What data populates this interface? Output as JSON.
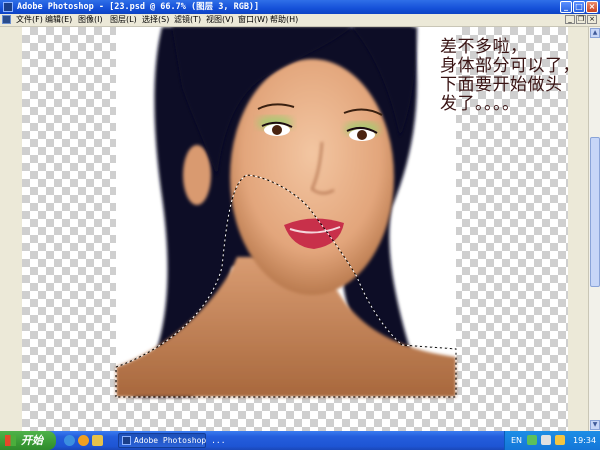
{
  "window": {
    "title": "Adobe Photoshop - [23.psd @ 66.7% (图层 3, RGB)]",
    "buttons": {
      "minimize": "_",
      "maximize": "□",
      "close": "×"
    }
  },
  "menu": {
    "items": [
      "文件(F)",
      "编辑(E)",
      "图像(I)",
      "图层(L)",
      "选择(S)",
      "滤镜(T)",
      "视图(V)",
      "窗口(W)",
      "帮助(H)"
    ],
    "mdi_buttons": {
      "minimize": "_",
      "restore": "❐",
      "close": "×"
    }
  },
  "document": {
    "caption_lines": [
      "差不多啦，",
      "身体部分可以了，",
      "下面要开始做头",
      "发了。。。。"
    ],
    "colors": {
      "hair": "#0a0a22",
      "skin": "#e8b08a",
      "lips": "#c8304a",
      "eyeshadow": "#9ccf6e",
      "checker": "#cfcfcf"
    }
  },
  "taskbar": {
    "start_label": "开始",
    "task_label": "Adobe Photoshop ...",
    "tray": {
      "lang": "EN",
      "clock": "19:34"
    }
  },
  "icons": [
    "photoshop-icon",
    "windows-flag-icon",
    "ie-icon",
    "media-player-icon",
    "folder-icon",
    "network-icon",
    "volume-icon"
  ]
}
